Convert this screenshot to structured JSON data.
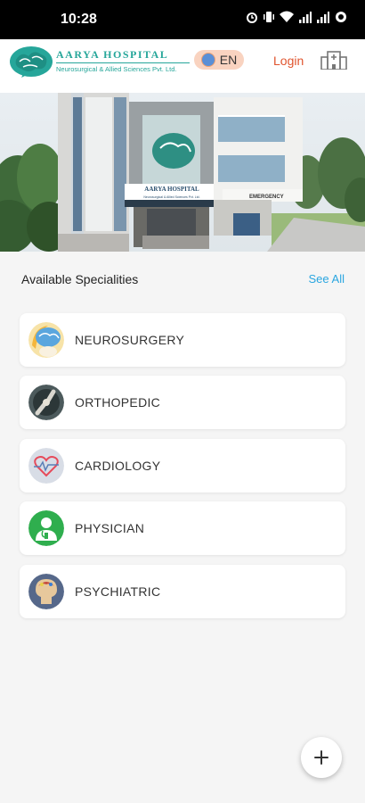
{
  "status_bar": {
    "time": "10:28",
    "icons": [
      "alarm-icon",
      "vibrate-icon",
      "wifi-icon",
      "signal-icon",
      "signal-icon",
      "data-saver-icon"
    ]
  },
  "header": {
    "brand_name": "AARYA HOSPITAL",
    "brand_subtitle": "Neurosurgical & Allied Sciences Pvt. Ltd.",
    "language": "EN",
    "login_label": "Login",
    "brand_color": "#26a69a",
    "login_color": "#e0542e"
  },
  "banner": {
    "sign_name": "AARYA HOSPITAL",
    "sign_sub": "Neurosurgical & Allied Sciences Pvt. Ltd.",
    "emergency_label": "EMERGENCY"
  },
  "specialities": {
    "title": "Available Specialities",
    "see_all_label": "See All",
    "see_all_color": "#2aa6e0",
    "items": [
      {
        "label": "NEUROSURGERY",
        "icon": "brain-icon"
      },
      {
        "label": "ORTHOPEDIC",
        "icon": "bone-joint-icon"
      },
      {
        "label": "CARDIOLOGY",
        "icon": "heart-icon"
      },
      {
        "label": "PHYSICIAN",
        "icon": "doctor-icon"
      },
      {
        "label": "PSYCHIATRIC",
        "icon": "head-icon"
      }
    ]
  },
  "fab": {
    "icon": "plus-icon"
  }
}
